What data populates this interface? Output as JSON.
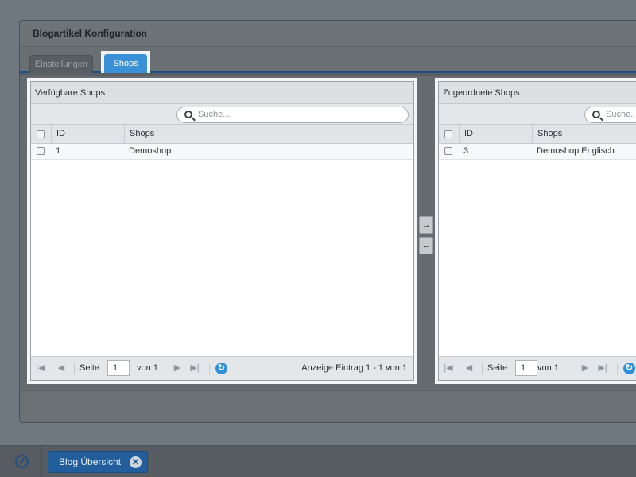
{
  "window": {
    "title": "Blogartikel Konfiguration"
  },
  "tabs": [
    {
      "label": "Einstellungen",
      "active": false
    },
    {
      "label": "Shops",
      "active": true
    }
  ],
  "left_panel": {
    "title": "Verfügbare Shops",
    "search_placeholder": "Suche...",
    "columns": [
      "ID",
      "Shops"
    ],
    "rows": [
      {
        "id": "1",
        "shop": "Demoshop"
      }
    ],
    "pager": {
      "page_label": "Seite",
      "page_value": "1",
      "of_label": "von 1",
      "summary": "Anzeige Eintrag 1 - 1 von 1"
    }
  },
  "right_panel": {
    "title": "Zugeordnete Shops",
    "search_placeholder": "Suche...",
    "columns": [
      "ID",
      "Shops"
    ],
    "rows": [
      {
        "id": "3",
        "shop": "Demoshop Englisch"
      }
    ],
    "pager": {
      "page_label": "Seite",
      "page_value": "1",
      "of_label": "von 1"
    }
  },
  "move_buttons": {
    "add": "→",
    "remove": "←"
  },
  "taskbar": {
    "item_label": "Blog Übersicht",
    "close_glyph": "✕"
  },
  "icons": {
    "pager_first": "|◀",
    "pager_prev": "◀",
    "pager_next": "▶",
    "pager_last": "▶|",
    "refresh": "↻"
  },
  "colors": {
    "accent": "#3b91d8",
    "tab_underline": "#1f4f86",
    "taskbar_button": "#235e9c"
  }
}
